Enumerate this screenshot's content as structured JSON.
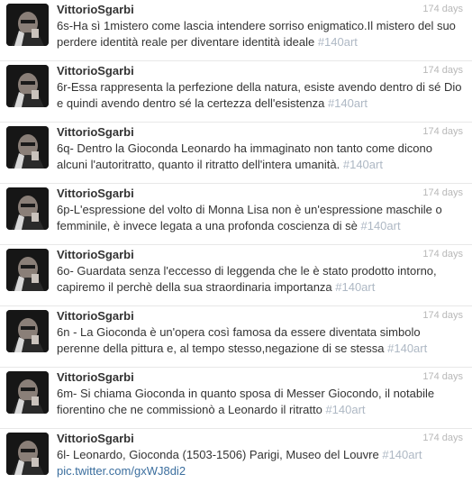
{
  "tweets": [
    {
      "username": "VittorioSgarbi",
      "time": "174 days",
      "line1": "6s-Ha sì 1mistero come lascia intendere sorriso enigmatico.Il mistero del suo",
      "line2": "perdere identità reale per diventare identità ideale ",
      "hashtag": "#140art"
    },
    {
      "username": "VittorioSgarbi",
      "time": "174 days",
      "line1": "6r-Essa rappresenta la perfezione della natura, esiste avendo dentro di sé Dio",
      "line2": "e quindi avendo dentro sé la certezza dell'esistenza ",
      "hashtag": "#140art"
    },
    {
      "username": "VittorioSgarbi",
      "time": "174 days",
      "line1": "6q- Dentro la Gioconda Leonardo ha immaginato non tanto come dicono",
      "line2": "alcuni l'autoritratto, quanto il ritratto dell'intera umanità. ",
      "hashtag": "#140art"
    },
    {
      "username": "VittorioSgarbi",
      "time": "174 days",
      "line1": "6p-L'espressione del volto di Monna Lisa non è un'espressione maschile o",
      "line2": "femminile, è invece legata a una profonda coscienza di sè ",
      "hashtag": "#140art"
    },
    {
      "username": "VittorioSgarbi",
      "time": "174 days",
      "line1": "6o- Guardata senza l'eccesso di leggenda che le è stato prodotto intorno,",
      "line2": "capiremo il perchè della sua straordinaria importanza ",
      "hashtag": "#140art"
    },
    {
      "username": "VittorioSgarbi",
      "time": "174 days",
      "line1": "6n - La Gioconda è un'opera così famosa da essere diventata simbolo",
      "line2": "perenne della pittura e, al tempo stesso,negazione di se stessa ",
      "hashtag": "#140art"
    },
    {
      "username": "VittorioSgarbi",
      "time": "174 days",
      "line1": "6m- Si chiama Gioconda in quanto sposa di Messer Giocondo, il notabile",
      "line2": "fiorentino che ne commissionò a Leonardo il ritratto ",
      "hashtag": "#140art"
    },
    {
      "username": "VittorioSgarbi",
      "time": "174 days",
      "line1": "6l- Leonardo, Gioconda (1503-1506) Parigi, Museo del Louvre ",
      "line1_hashtag": "#140art",
      "line2_link": "pic.twitter.com/gxWJ8di2"
    }
  ]
}
